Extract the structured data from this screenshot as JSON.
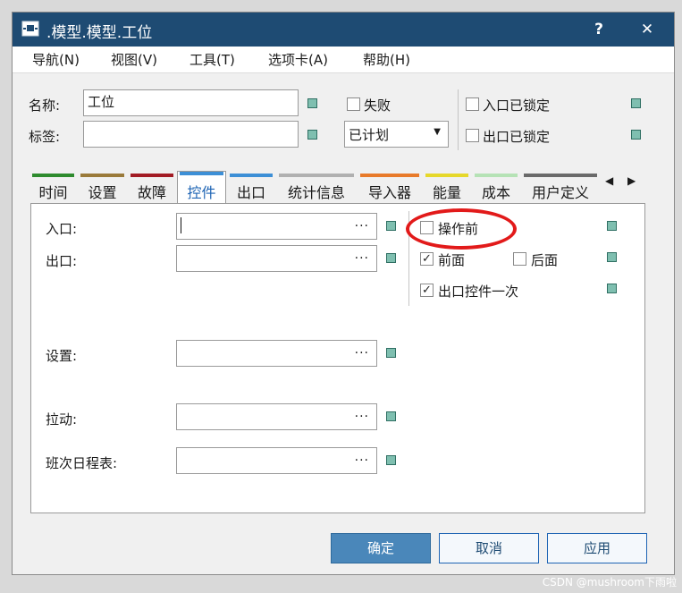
{
  "window": {
    "title": ".模型.模型.工位",
    "help_glyph": "?",
    "close_glyph": "✕"
  },
  "menu": {
    "items": [
      "导航(N)",
      "视图(V)",
      "工具(T)",
      "选项卡(A)",
      "帮助(H)"
    ]
  },
  "header": {
    "name_label": "名称:",
    "name_value": "工位",
    "tag_label": "标签:",
    "tag_value": "",
    "failed_label": "失败",
    "plan_value": "已计划",
    "entry_locked_label": "入口已锁定",
    "exit_locked_label": "出口已锁定",
    "failed_checked": false,
    "entry_locked_checked": false,
    "exit_locked_checked": false
  },
  "tabs": [
    {
      "label": "时间",
      "color": "#2e8b2e"
    },
    {
      "label": "设置",
      "color": "#9a7a3a"
    },
    {
      "label": "故障",
      "color": "#a21b24"
    },
    {
      "label": "控件",
      "color": "#3d8fd6",
      "active": true
    },
    {
      "label": "出口",
      "color": "#3d8fd6"
    },
    {
      "label": "统计信息",
      "color": "#b0b0b0"
    },
    {
      "label": "导入器",
      "color": "#e87a2a"
    },
    {
      "label": "能量",
      "color": "#e6d82a"
    },
    {
      "label": "成本",
      "color": "#b5e2b5"
    },
    {
      "label": "用户定义",
      "color": "#6a6a6a"
    }
  ],
  "tab_nav": {
    "prev": "◀",
    "next": "▶"
  },
  "controls": {
    "entry_label": "入口:",
    "exit_label": "出口:",
    "setup_label": "设置:",
    "pull_label": "拉动:",
    "shift_label": "班次日程表:",
    "browse_dots": "...",
    "before_op_label": "操作前",
    "before_op_checked": false,
    "front_label": "前面",
    "front_checked": true,
    "back_label": "后面",
    "back_checked": false,
    "exit_once_label": "出口控件一次",
    "exit_once_checked": true,
    "check_glyph": "✓"
  },
  "buttons": {
    "ok": "确定",
    "cancel": "取消",
    "apply": "应用"
  },
  "watermark": "CSDN @mushroom下雨啦"
}
